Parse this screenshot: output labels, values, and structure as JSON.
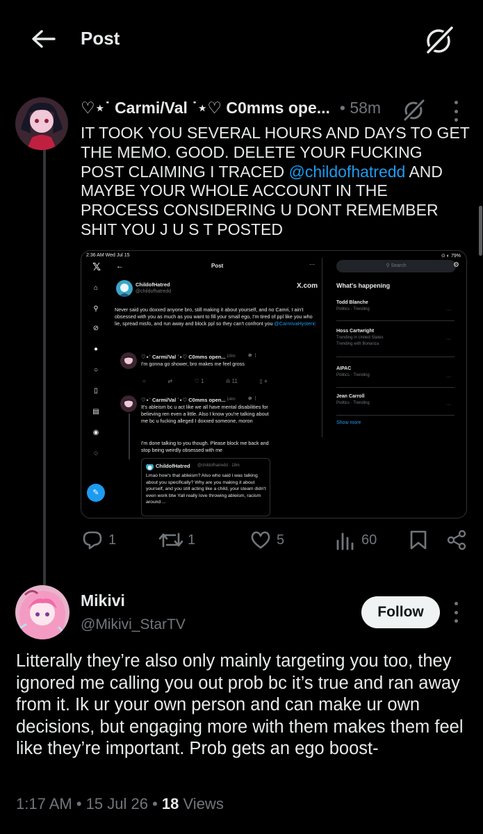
{
  "header": {
    "title": "Post"
  },
  "tweet": {
    "display_name": "♡⋆˙ Carmi/Val ˙⋆♡ C0mms ope...",
    "time": "• 58m",
    "text_before": "IT TOOK YOU SEVERAL HOURS AND DAYS TO GET THE MEMO. GOOD. DELETE YOUR FUCKING POST CLAIMING I TRACED ",
    "mention": "@childofhatredd",
    "text_after": " AND MAYBE YOUR WHOLE ACCOUNT IN THE PROCESS CONSIDERING U DONT REMEMBER SHIT YOU J U S T POSTED",
    "actions": {
      "replies": "1",
      "reposts": "1",
      "likes": "5",
      "views": "60"
    }
  },
  "embedded_screenshot": {
    "status_time": "2:36 AM  Wed Jul 15",
    "status_right": "⊙ ◐ 79%",
    "title": "Post",
    "search_placeholder": "Search",
    "author_name": "ChildofHatred",
    "author_handle": "@childofhatredd",
    "xcom_label": "X.com",
    "body_before": "Never said you doxxed anyone bro,  still making it about yourself,  and no Camri, I ain't obsessed with you as much as you want to fill your small ego, I'm tired of ppl like you who lie,  spread misfo, and run away and block ppl so they can't confront you ",
    "body_mention": "@CarmivaHysteric",
    "reply1": {
      "name": "♡⋆˙ Carmi/Val ˙⋆♡ C0mms open...",
      "time": "· 10m",
      "text": "I'm gonna go shower, bro makes me feel gross"
    },
    "reply1_actions": {
      "likes": "1",
      "views": "11"
    },
    "reply2": {
      "name": "♡⋆˙ Carmi/Val ˙⋆♡ C0mms open...",
      "time": "· 14m",
      "text": "It's ableism bc u act like we all have mental disabilities for believing ren even a little. Also I know you're talking about me bc u fucking alleged I doxxed someone, moron",
      "text2": "I'm done talking to you though. Please block me back and stop being weirdly obsessed with me"
    },
    "quote": {
      "name": "ChildofHatred",
      "handle": "@childofhatredd · 18m",
      "text": "Lmao how's that ableism? Also who said i was talking about you specifically? Why are you making it about yourself, and you still acting like a child, your steam didn't even work btw Yall really love throwing ableism, racism around ..."
    },
    "whats_happening": "What's happening",
    "trends": [
      {
        "name": "Todd Blanche",
        "category": "Politics · Trending"
      },
      {
        "name": "Hoss Cartwright",
        "category": "Trending in United States",
        "extra": "Trending with Bonanza"
      },
      {
        "name": "AIPAC",
        "category": "Politics · Trending"
      },
      {
        "name": "Jean Carroll",
        "category": "Politics · Trending"
      }
    ],
    "show_more": "Show more"
  },
  "reply": {
    "display_name": "Mikivi",
    "handle": "@Mikivi_StarTV",
    "follow_label": "Follow",
    "text": "Litterally they’re also only mainly targeting you too, they ignored me calling you out prob bc it’s true and ran away from it. Ik ur your own person and can make ur own decisions, but engaging more with them makes them feel like they’re important. Prob gets an ego boost-",
    "time": "1:17 AM",
    "date": "15 Jul 26",
    "views_count": "18",
    "views_label": "Views"
  },
  "colors": {
    "accent": "#1d9bf0",
    "background": "#000000",
    "muted": "#71767b",
    "text": "#e7e9ea"
  },
  "icons": [
    "back-arrow-icon",
    "grok-icon",
    "more-icon",
    "reply-icon",
    "repost-icon",
    "like-icon",
    "views-icon",
    "bookmark-icon",
    "share-icon"
  ]
}
